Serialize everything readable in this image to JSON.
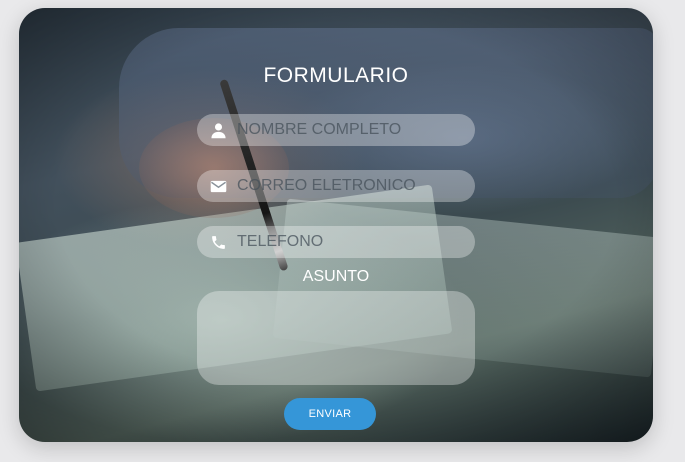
{
  "form": {
    "title": "FORMULARIO",
    "fields": [
      {
        "icon": "user-icon",
        "placeholder": "NOMBRE COMPLETO",
        "value": ""
      },
      {
        "icon": "envelope-icon",
        "placeholder": "CORREO ELETRONICO",
        "value": ""
      },
      {
        "icon": "phone-icon",
        "placeholder": "TELEFONO",
        "value": ""
      }
    ],
    "asunto_label": "ASUNTO",
    "asunto_value": "",
    "submit_label": "ENVIAR"
  },
  "colors": {
    "button": "#3596d8",
    "text": "#ffffff",
    "field_bg": "rgba(255,255,255,0.33)"
  }
}
